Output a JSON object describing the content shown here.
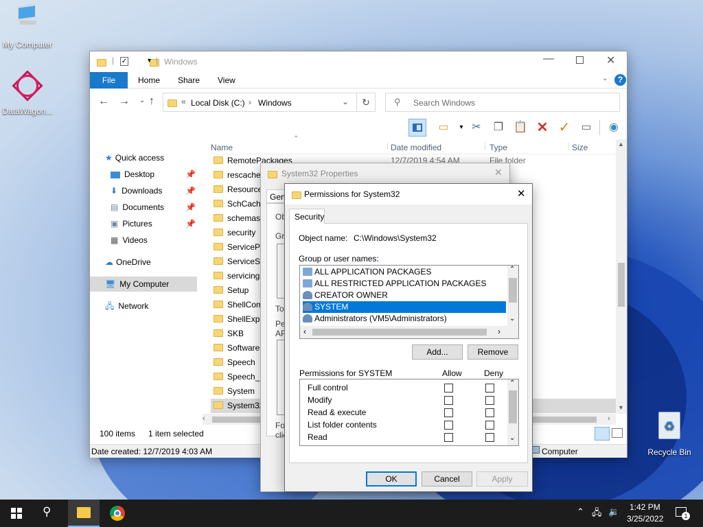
{
  "desktop": {
    "icons": [
      {
        "label": "My Computer"
      },
      {
        "label": "DataWagon..."
      },
      {
        "label": "Recycle Bin"
      }
    ]
  },
  "explorer": {
    "title": "Windows",
    "ribbon_tabs": [
      "File",
      "Home",
      "Share",
      "View"
    ],
    "address": {
      "root": "Local Disk (C:)",
      "current": "Windows"
    },
    "search_placeholder": "Search Windows",
    "columns": {
      "name": "Name",
      "date": "Date modified",
      "type": "Type",
      "size": "Size"
    },
    "visible_row": {
      "date": "12/7/2019 4:54 AM",
      "type": "File folder"
    },
    "nav": {
      "quick_access": "Quick access",
      "items": [
        "Desktop",
        "Downloads",
        "Documents",
        "Pictures",
        "Videos"
      ],
      "onedrive": "OneDrive",
      "my_computer": "My Computer",
      "network": "Network"
    },
    "files": [
      "RemotePackages",
      "rescache",
      "Resources",
      "SchCache",
      "schemas",
      "security",
      "ServicePro",
      "ServiceSta",
      "servicing",
      "Setup",
      "ShellCom",
      "ShellExper",
      "SKB",
      "SoftwareD",
      "Speech",
      "Speech_O",
      "System",
      "System32"
    ],
    "status": {
      "count": "100 items",
      "selected": "1 item selected"
    },
    "details_bar": {
      "created": "Date created: 12/7/2019 4:03 AM",
      "location": "Computer"
    }
  },
  "props": {
    "title": "System32 Properties",
    "tab_partial": "Gen",
    "peek": [
      "Ob",
      "Gr",
      "To",
      "Pe",
      "AP",
      "Fo",
      "clic"
    ]
  },
  "perm": {
    "title": "Permissions for System32",
    "tab": "Security",
    "object_label": "Object name:",
    "object_value": "C:\\Windows\\System32",
    "group_label": "Group or user names:",
    "users": [
      {
        "name": "ALL APPLICATION PACKAGES",
        "selected": false
      },
      {
        "name": "ALL RESTRICTED APPLICATION PACKAGES",
        "selected": false
      },
      {
        "name": "CREATOR OWNER",
        "selected": false
      },
      {
        "name": "SYSTEM",
        "selected": true
      },
      {
        "name": "Administrators (VM5\\Administrators)",
        "selected": false
      }
    ],
    "add_label": "Add...",
    "remove_label": "Remove",
    "perm_header": "Permissions for SYSTEM",
    "allow": "Allow",
    "deny": "Deny",
    "permissions": [
      "Full control",
      "Modify",
      "Read & execute",
      "List folder contents",
      "Read"
    ],
    "ok": "OK",
    "cancel": "Cancel",
    "apply": "Apply"
  },
  "taskbar": {
    "time": "1:42 PM",
    "date": "3/25/2022",
    "notification_count": "1"
  },
  "colors": {
    "selection": "#0078d7",
    "file_tab": "#1979ca"
  }
}
